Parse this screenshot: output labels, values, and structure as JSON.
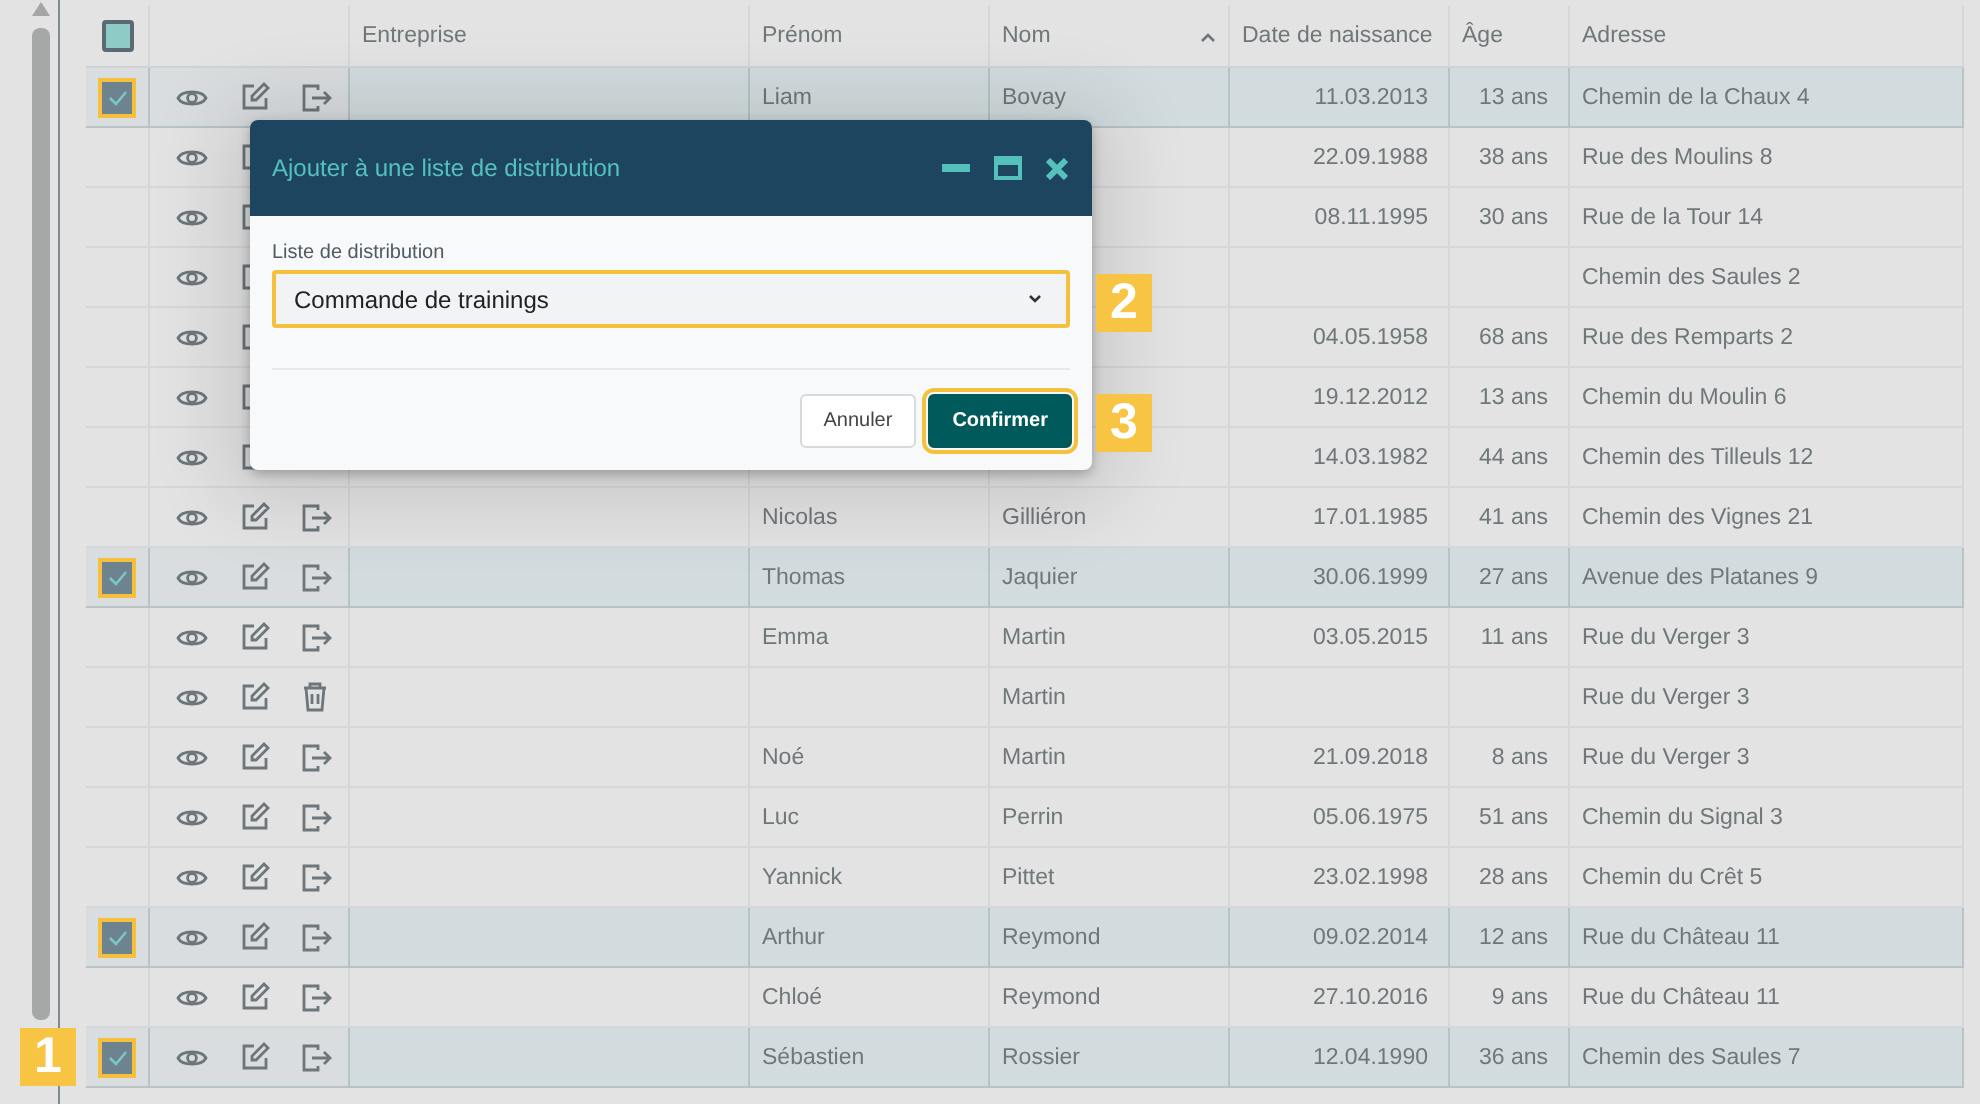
{
  "table": {
    "header_checkbox": {
      "indeterminate": true
    },
    "columns": [
      {
        "label": "Entreprise",
        "sorted": false
      },
      {
        "label": "Prénom",
        "sorted": false
      },
      {
        "label": "Nom",
        "sorted": true
      },
      {
        "label": "Date de naissance",
        "sorted": false
      },
      {
        "label": "Âge",
        "sorted": false
      },
      {
        "label": "Adresse",
        "sorted": false
      }
    ],
    "rows": [
      {
        "selected": true,
        "kind": "linked",
        "first_name": "Liam",
        "last_name": "Bovay",
        "birth_date": "11.03.2013",
        "age": "13 ans",
        "address": "Chemin de la Chaux 4"
      },
      {
        "selected": false,
        "birth_date": "22.09.1988",
        "age": "38 ans",
        "address": "Rue des Moulins 8"
      },
      {
        "selected": false,
        "birth_date": "08.11.1995",
        "age": "30 ans",
        "address": "Rue de la Tour 14"
      },
      {
        "selected": false,
        "address": "Chemin des Saules 2"
      },
      {
        "selected": false,
        "birth_date": "04.05.1958",
        "age": "68 ans",
        "address": "Rue des Remparts 2"
      },
      {
        "selected": false,
        "birth_date": "19.12.2012",
        "age": "13 ans",
        "address": "Chemin du Moulin 6"
      },
      {
        "selected": false,
        "birth_date": "14.03.1982",
        "age": "44 ans",
        "address": "Chemin des Tilleuls 12"
      },
      {
        "selected": false,
        "kind": "linked",
        "first_name": "Nicolas",
        "last_name": "Gilliéron",
        "birth_date": "17.01.1985",
        "age": "41 ans",
        "address": "Chemin des Vignes 21"
      },
      {
        "selected": true,
        "kind": "linked",
        "first_name": "Thomas",
        "last_name": "Jaquier",
        "birth_date": "30.06.1999",
        "age": "27 ans",
        "address": "Avenue des Platanes 9"
      },
      {
        "selected": false,
        "kind": "linked",
        "first_name": "Emma",
        "last_name": "Martin",
        "birth_date": "03.05.2015",
        "age": "11 ans",
        "address": "Rue du Verger 3"
      },
      {
        "selected": false,
        "kind": "removable",
        "last_name": "Martin",
        "address": "Rue du Verger 3"
      },
      {
        "selected": false,
        "kind": "linked",
        "first_name": "Noé",
        "last_name": "Martin",
        "birth_date": "21.09.2018",
        "age": "8 ans",
        "address": "Rue du Verger 3"
      },
      {
        "selected": false,
        "kind": "linked",
        "first_name": "Luc",
        "last_name": "Perrin",
        "birth_date": "05.06.1975",
        "age": "51 ans",
        "address": "Chemin du Signal 3"
      },
      {
        "selected": false,
        "kind": "linked",
        "first_name": "Yannick",
        "last_name": "Pittet",
        "birth_date": "23.02.1998",
        "age": "28 ans",
        "address": "Chemin du Crêt 5"
      },
      {
        "selected": true,
        "kind": "linked",
        "first_name": "Arthur",
        "last_name": "Reymond",
        "birth_date": "09.02.2014",
        "age": "12 ans",
        "address": "Rue du Château 11"
      },
      {
        "selected": false,
        "kind": "linked",
        "first_name": "Chloé",
        "last_name": "Reymond",
        "birth_date": "27.10.2016",
        "age": "9 ans",
        "address": "Rue du Château 11"
      },
      {
        "selected": true,
        "kind": "linked",
        "first_name": "Sébastien",
        "last_name": "Rossier",
        "birth_date": "12.04.1990",
        "age": "36 ans",
        "address": "Chemin des Saules 7"
      }
    ]
  },
  "dialog": {
    "title": "Ajouter à une liste de distribution",
    "field": {
      "label": "Liste de distribution",
      "value": "Commande de trainings",
      "highlighted": true
    },
    "buttons": [
      {
        "label": "Annuler",
        "kind": "secondary",
        "highlighted": false
      },
      {
        "label": "Confirmer",
        "kind": "primary",
        "highlighted": true
      }
    ]
  },
  "callouts": [
    {
      "number": "1",
      "kind": "row"
    },
    {
      "number": "2",
      "kind": "field"
    },
    {
      "number": "3",
      "kind": "button"
    }
  ]
}
